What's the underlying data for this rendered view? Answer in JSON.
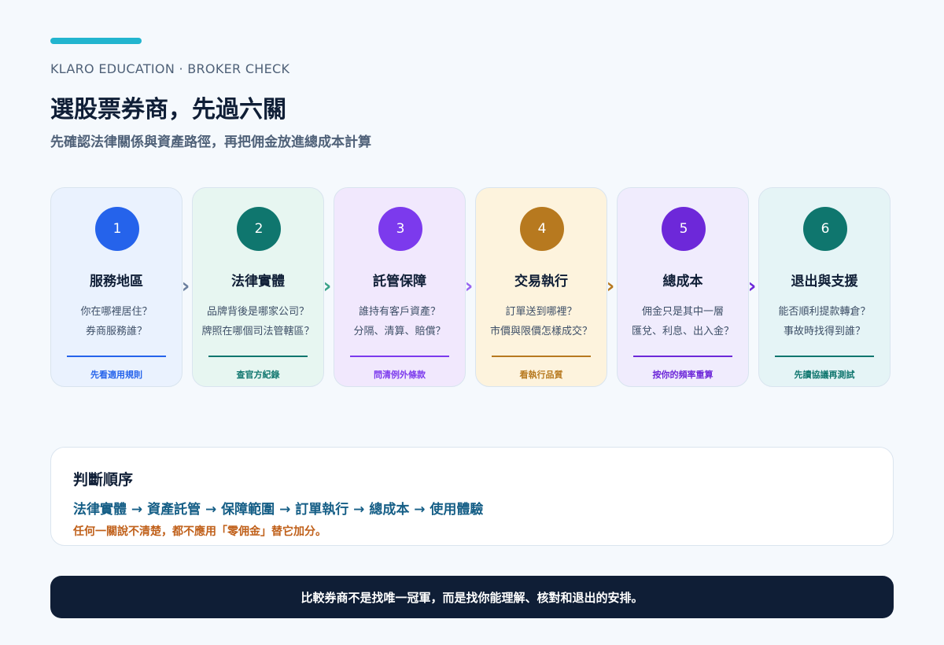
{
  "header": {
    "kicker": "KLARO EDUCATION · BROKER CHECK",
    "title": "選股票券商，先過六關",
    "subtitle": "先確認法律關係與資產路徑，再把佣金放進總成本計算"
  },
  "steps": [
    {
      "num": "1",
      "title": "服務地區",
      "q1": "你在哪裡居住？",
      "q2": "券商服務誰？",
      "action": "先看適用規則",
      "accent": "#2563eb",
      "bg": "#eaf2fe",
      "arrow": "#6b7f9e"
    },
    {
      "num": "2",
      "title": "法律實體",
      "q1": "品牌背後是哪家公司？",
      "q2": "牌照在哪個司法管轄區？",
      "action": "查官方紀錄",
      "accent": "#0f766e",
      "bg": "#e7f6f1",
      "arrow": "#3aa287"
    },
    {
      "num": "3",
      "title": "託管保障",
      "q1": "誰持有客戶資產？",
      "q2": "分隔、清算、賠償？",
      "action": "問清例外條款",
      "accent": "#7c3aed",
      "bg": "#f1e8fd",
      "arrow": "#9865f0"
    },
    {
      "num": "4",
      "title": "交易執行",
      "q1": "訂單送到哪裡？",
      "q2": "市價與限價怎樣成交？",
      "action": "看執行品質",
      "accent": "#b7791f",
      "bg": "#fdf3dd",
      "arrow": "#b7791f"
    },
    {
      "num": "5",
      "title": "總成本",
      "q1": "佣金只是其中一層",
      "q2": "匯兌、利息、出入金？",
      "action": "按你的頻率重算",
      "accent": "#6d28d9",
      "bg": "#f0ecfd",
      "arrow": "#6d28d9"
    },
    {
      "num": "6",
      "title": "退出與支援",
      "q1": "能否順利提款轉倉？",
      "q2": "事故時找得到誰？",
      "action": "先讀協議再測試",
      "accent": "#0f766e",
      "bg": "#e5f4f6",
      "arrow": null
    }
  ],
  "panel": {
    "title": "判斷順序",
    "sequence": "法律實體 → 資產託管 → 保障範圍 → 訂單執行 → 總成本 → 使用體驗",
    "warning": "任何一關說不清楚，都不應用「零佣金」替它加分。"
  },
  "footer": {
    "text": "比較券商不是找唯一冠軍，而是找你能理解、核對和退出的安排。"
  },
  "icons": {
    "arrow_glyph": "›"
  }
}
